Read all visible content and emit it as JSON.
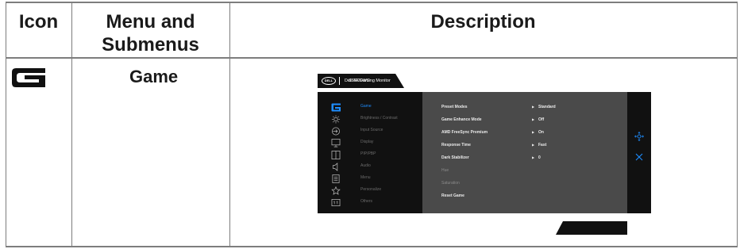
{
  "table": {
    "headers": {
      "icon": "Icon",
      "menu_line1": "Menu and",
      "menu_line2": "Submenus",
      "description": "Description"
    },
    "row": {
      "icon_name": "game-g-icon",
      "menu": "Game"
    }
  },
  "osd": {
    "logo_text": "DELL",
    "title": "Dell 34 Gaming Monitor",
    "menu_items": [
      {
        "label": "Game",
        "icon": "game-icon",
        "active": true
      },
      {
        "label": "Brightness / Contrast",
        "icon": "brightness-icon",
        "active": false
      },
      {
        "label": "Input Source",
        "icon": "input-source-icon",
        "active": false
      },
      {
        "label": "Display",
        "icon": "display-icon",
        "active": false
      },
      {
        "label": "PIP/PBP",
        "icon": "pip-pbp-icon",
        "active": false
      },
      {
        "label": "Audio",
        "icon": "audio-icon",
        "active": false
      },
      {
        "label": "Menu",
        "icon": "menu-icon",
        "active": false
      },
      {
        "label": "Personalize",
        "icon": "star-icon",
        "active": false
      },
      {
        "label": "Others",
        "icon": "others-icon",
        "active": false
      }
    ],
    "settings": [
      {
        "label": "Preset Modes",
        "value": "Standard",
        "enabled": true
      },
      {
        "label": "Game Enhance Mode",
        "value": "Off",
        "enabled": true
      },
      {
        "label": "AMD FreeSync Premium",
        "value": "On",
        "enabled": true
      },
      {
        "label": "Response Time",
        "value": "Fast",
        "enabled": true
      },
      {
        "label": "Dark Stabilizer",
        "value": "0",
        "enabled": true
      },
      {
        "label": "Hue",
        "value": "",
        "enabled": false
      },
      {
        "label": "Saturation",
        "value": "",
        "enabled": false
      },
      {
        "label": "Reset Game",
        "value": "",
        "enabled": true
      }
    ],
    "side_icons": [
      "move-icon",
      "close-icon"
    ],
    "model": "S3422DWG",
    "colors": {
      "accent": "#1e8dff",
      "panel": "#111111",
      "content": "#4a4a4a"
    }
  }
}
